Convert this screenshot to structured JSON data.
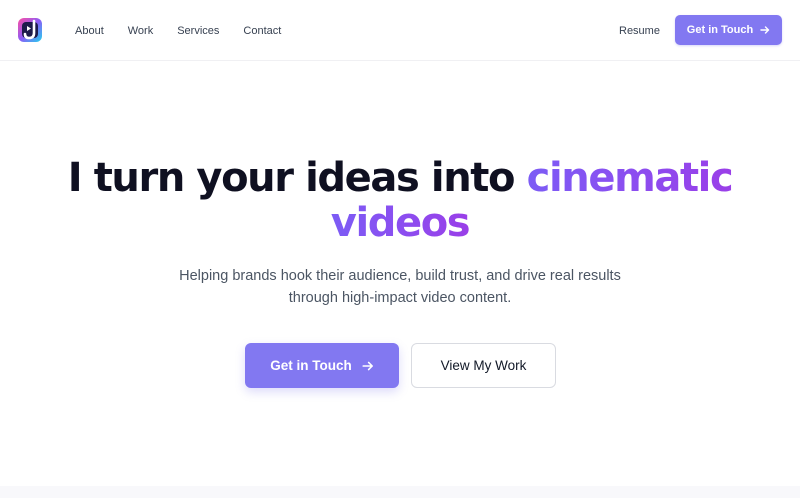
{
  "header": {
    "logo_icon": "j-play-logo-icon",
    "nav": [
      {
        "label": "About"
      },
      {
        "label": "Work"
      },
      {
        "label": "Services"
      },
      {
        "label": "Contact"
      }
    ],
    "resume_label": "Resume",
    "cta_label": "Get in Touch"
  },
  "hero": {
    "title_main": "I turn your ideas into",
    "title_accent_1": "cinematic",
    "title_accent_2": "videos",
    "subtitle_line1": "Helping brands hook their audience, build trust, and drive real results",
    "subtitle_line2": "through high-impact video content.",
    "primary_button": "Get in Touch",
    "secondary_button": "View My Work"
  },
  "colors": {
    "accent": "#8278f1",
    "gradient_start": "#7c5cf5",
    "gradient_end": "#9a3fe8",
    "heading": "#0f1021"
  }
}
